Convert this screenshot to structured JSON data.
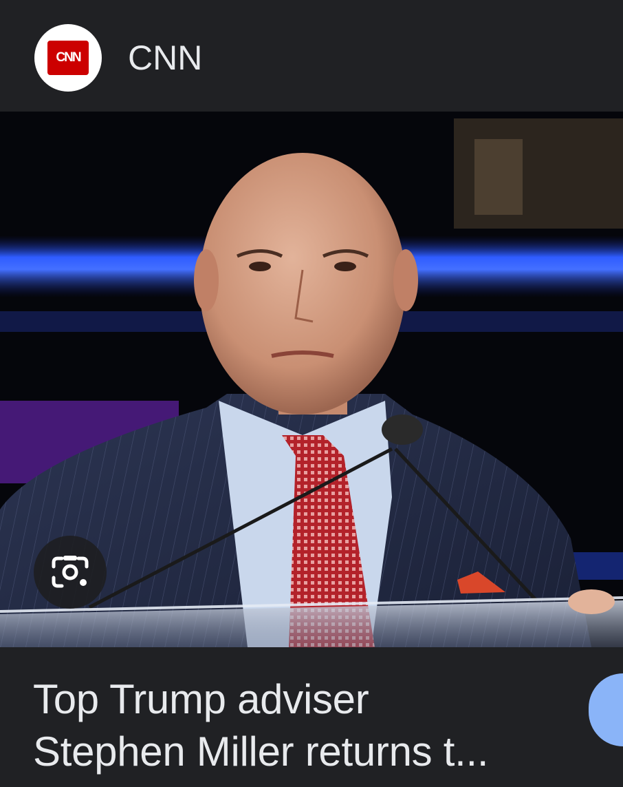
{
  "source": {
    "name": "CNN",
    "logo_text": "CNN"
  },
  "image": {
    "subject": "news-photo-speaker-at-podium"
  },
  "lens": {
    "icon": "google-lens-icon"
  },
  "article": {
    "headline_line1": "Top Trump adviser",
    "headline_line2": "Stephen Miller returns t..."
  },
  "colors": {
    "background": "#202124",
    "text": "#e8eaed",
    "cnn_red": "#cc0000",
    "accent_blue": "#8ab4f8"
  }
}
